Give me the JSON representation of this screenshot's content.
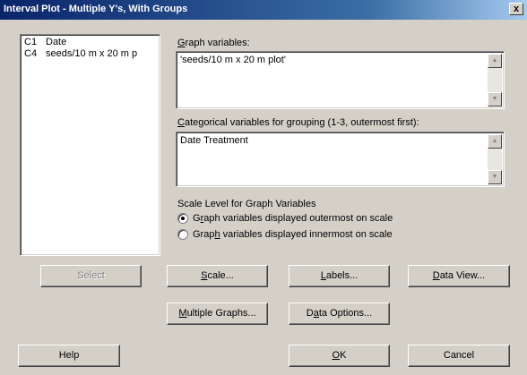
{
  "window": {
    "title": "Interval Plot - Multiple Y's, With Groups",
    "close_glyph": "x"
  },
  "variables": [
    {
      "column": "C1",
      "name": "Date"
    },
    {
      "column": "C4",
      "name": "seeds/10 m x 20 m p"
    }
  ],
  "graph_variables": {
    "label_mnemonic": "G",
    "label_rest": "raph variables:",
    "value": "'seeds/10 m x 20 m plot'"
  },
  "categorical": {
    "label_mnemonic": "C",
    "label_rest": "ategorical variables for grouping (1-3, outermost first):",
    "value": "Date Treatment"
  },
  "scale_level": {
    "heading": "Scale Level for Graph Variables",
    "options": [
      {
        "pre": "G",
        "mnemonic": "r",
        "post": "aph variables displayed outermost on scale",
        "selected": true
      },
      {
        "pre": "Grap",
        "mnemonic": "h",
        "post": " variables displayed innermost on scale",
        "selected": false
      }
    ]
  },
  "buttons": {
    "select": "Select",
    "scale": {
      "mnemonic": "S",
      "rest": "cale..."
    },
    "labels": {
      "mnemonic": "L",
      "rest": "abels..."
    },
    "data_view": {
      "mnemonic": "D",
      "rest": "ata View..."
    },
    "multiple_graphs": {
      "mnemonic": "M",
      "rest": "ultiple Graphs..."
    },
    "data_options": {
      "pre": "D",
      "mnemonic": "a",
      "post": "ta Options..."
    },
    "help": "Help",
    "ok": {
      "mnemonic": "O",
      "rest": "K"
    },
    "cancel": "Cancel"
  }
}
